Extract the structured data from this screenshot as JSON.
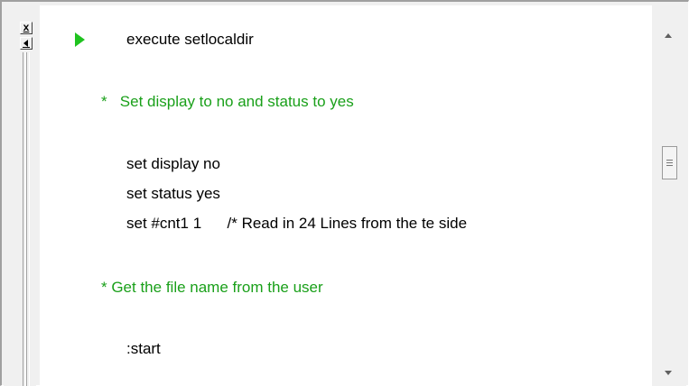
{
  "toolbar": {
    "close_label": "x",
    "collapse_label": ""
  },
  "editor": {
    "lines": [
      {
        "text": "execute setlocaldir",
        "kind": "code"
      },
      {
        "text": "*   Set display to no and status to yes",
        "kind": "comment"
      },
      {
        "text": "set display no",
        "kind": "code"
      },
      {
        "text": "set status yes",
        "kind": "code"
      },
      {
        "text": "set #cnt1 1      /* Read in 24 Lines from the te side",
        "kind": "code"
      },
      {
        "text": "* Get the file name from the user",
        "kind": "comment"
      },
      {
        "text": ":start",
        "kind": "code"
      }
    ],
    "current_line_marker": "run-arrow"
  },
  "colors": {
    "comment": "#1aa01a",
    "marker": "#1fc31f",
    "background": "#ffffff"
  },
  "scrollbar": {
    "position_fraction": 0.38
  }
}
